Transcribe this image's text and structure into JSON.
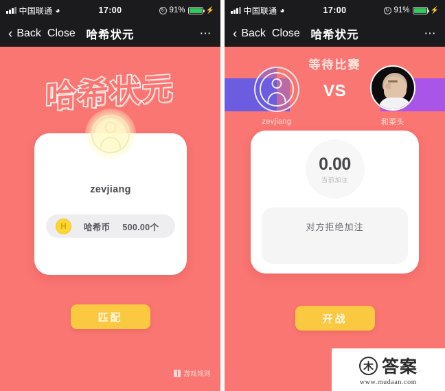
{
  "colors": {
    "background": "#FA7672",
    "accent_yellow": "#FBC841",
    "band_left": "#6B5CE0",
    "band_right": "#A855E8",
    "card_white": "#FFFFFF",
    "statusbar": "#1B1B1D",
    "battery_green": "#34C759"
  },
  "status_bar": {
    "carrier": "中国联通",
    "wifi_icon": "wifi-icon",
    "signal_icon": "signal-bars-icon",
    "time": "17:00",
    "rotation_lock_icon": "rotation-lock-icon",
    "battery_percent": "91%",
    "battery_icon": "battery-icon",
    "charging_icon": "lightning-bolt-icon"
  },
  "nav_bar": {
    "back_icon": "chevron-left-icon",
    "back_label": "Back",
    "close_label": "Close",
    "title": "哈希状元",
    "more_icon": "more-dots-icon"
  },
  "left_screen": {
    "logo_text": "哈希状元",
    "avatar_icon": "person-avatar-icon",
    "username": "zevjiang",
    "coin_icon": "hash-coin-icon",
    "coin_symbol": "H",
    "balance_label": "哈希币",
    "balance_value": "500.00个",
    "match_button": "匹配",
    "rules_icon": "book-icon",
    "rules_label": "游戏规则"
  },
  "right_screen": {
    "waiting_title": "等待比赛",
    "player_one": {
      "avatar_icon": "person-avatar-icon",
      "name": "zevjiang"
    },
    "vs_label": "VS",
    "player_two": {
      "avatar_icon": "opponent-photo-avatar",
      "name": "和菜头"
    },
    "bet_amount": "0.00",
    "bet_label": "当前加注",
    "bet_message": "对方拒绝加注",
    "start_button": "开战"
  },
  "watermark": {
    "seal_char": "木",
    "brand": "答案",
    "url": "www.mudaan.com"
  }
}
